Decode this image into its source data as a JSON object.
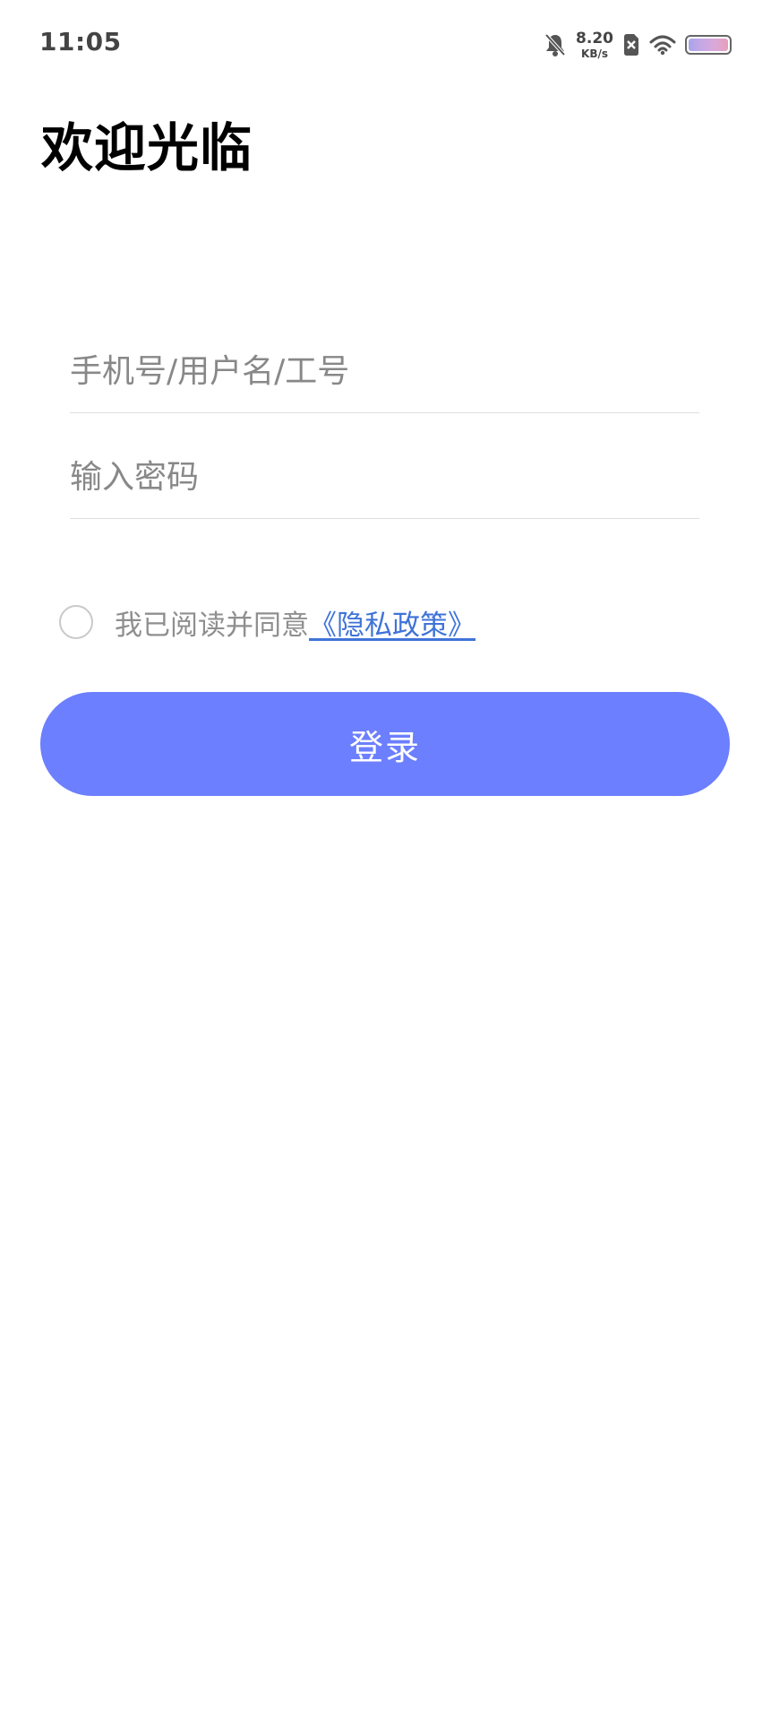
{
  "status_bar": {
    "time": "11:05",
    "net_speed_value": "8.20",
    "net_speed_unit": "KB/s",
    "icons": [
      "bell-off-icon",
      "sim-x-icon",
      "wifi-icon",
      "battery-icon"
    ],
    "battery_gradient": [
      "#a8a4ea",
      "#e79eb9"
    ]
  },
  "page": {
    "title": "欢迎光临"
  },
  "form": {
    "username_placeholder": "手机号/用户名/工号",
    "password_placeholder": "输入密码",
    "agreement_text": "我已阅读并同意",
    "agreement_link": "《隐私政策》",
    "login_label": "登录"
  },
  "colors": {
    "primary": "#6c7ffe",
    "link": "#3f73d8",
    "placeholder": "#888888"
  }
}
